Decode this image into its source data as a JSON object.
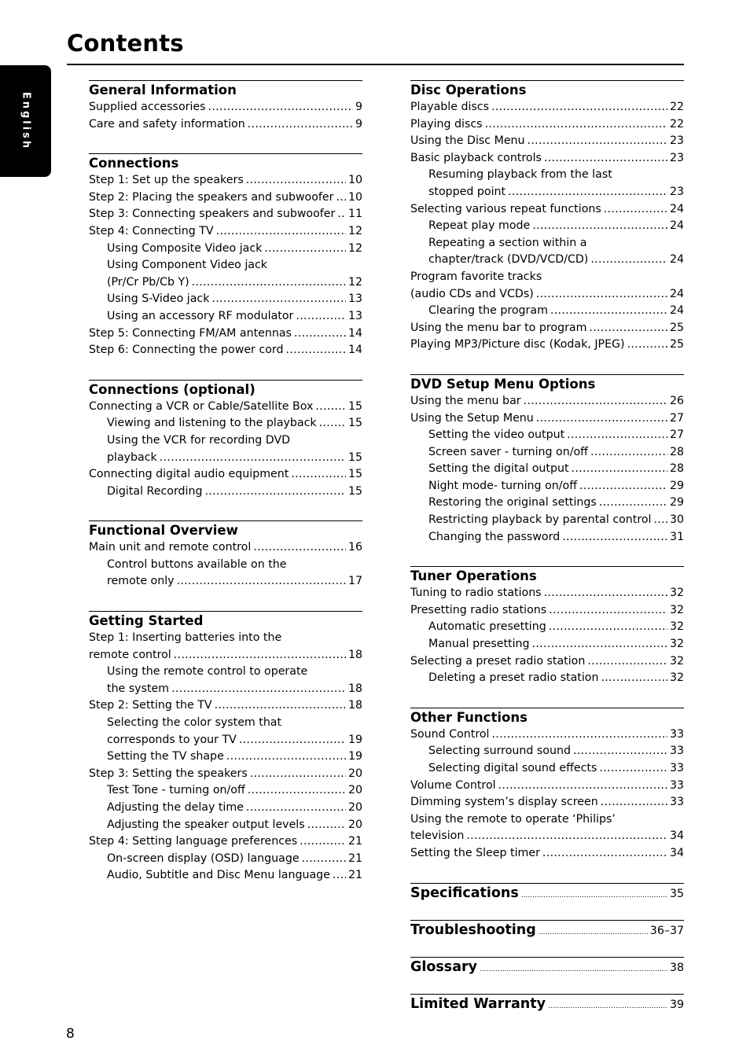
{
  "title": "Contents",
  "language_tab": "English",
  "page_number": "8",
  "left_column": [
    {
      "heading": "General Information",
      "entries": [
        {
          "label": "Supplied accessories",
          "page": "9",
          "indent": false
        },
        {
          "label": "Care and safety information",
          "page": "9",
          "indent": false
        }
      ]
    },
    {
      "heading": "Connections",
      "entries": [
        {
          "label": "Step 1: Set up the speakers",
          "page": "10",
          "indent": false
        },
        {
          "label": "Step 2: Placing the speakers and subwoofer",
          "page": "10",
          "indent": false
        },
        {
          "label": "Step 3: Connecting speakers and subwoofer",
          "page": "11",
          "indent": false
        },
        {
          "label": "Step 4: Connecting TV",
          "page": "12",
          "indent": false
        },
        {
          "label": "Using Composite Video jack",
          "page": "12",
          "indent": true
        },
        {
          "label": "Using Component Video jack",
          "page": "",
          "indent": true,
          "wrap": true
        },
        {
          "label": "(Pr/Cr Pb/Cb Y)",
          "page": "12",
          "indent": true
        },
        {
          "label": "Using S-Video jack",
          "page": "13",
          "indent": true
        },
        {
          "label": "Using an accessory RF modulator",
          "page": "13",
          "indent": true
        },
        {
          "label": "Step 5: Connecting FM/AM antennas",
          "page": "14",
          "indent": false
        },
        {
          "label": "Step 6: Connecting the power cord",
          "page": "14",
          "indent": false
        }
      ]
    },
    {
      "heading": "Connections (optional)",
      "entries": [
        {
          "label": "Connecting a VCR or Cable/Satellite Box",
          "page": "15",
          "indent": false
        },
        {
          "label": "Viewing and listening to the playback",
          "page": "15",
          "indent": true
        },
        {
          "label": "Using the VCR for recording DVD",
          "page": "",
          "indent": true,
          "wrap": true
        },
        {
          "label": "playback",
          "page": "15",
          "indent": true
        },
        {
          "label": "Connecting digital audio equipment",
          "page": "15",
          "indent": false
        },
        {
          "label": "Digital Recording",
          "page": "15",
          "indent": true
        }
      ]
    },
    {
      "heading": "Functional Overview",
      "entries": [
        {
          "label": "Main unit and remote control",
          "page": "16",
          "indent": false
        },
        {
          "label": "Control buttons available on the",
          "page": "",
          "indent": true,
          "wrap": true
        },
        {
          "label": "remote only",
          "page": "17",
          "indent": true
        }
      ]
    },
    {
      "heading": "Getting Started",
      "entries": [
        {
          "label": "Step 1: Inserting batteries into the",
          "page": "",
          "indent": false,
          "wrap": true
        },
        {
          "label": "remote control",
          "page": "18",
          "indent": false
        },
        {
          "label": "Using the remote control to operate",
          "page": "",
          "indent": true,
          "wrap": true
        },
        {
          "label": "the system",
          "page": "18",
          "indent": true
        },
        {
          "label": "Step 2: Setting the TV",
          "page": "18",
          "indent": false
        },
        {
          "label": "Selecting the color system that",
          "page": "",
          "indent": true,
          "wrap": true
        },
        {
          "label": "corresponds to your TV",
          "page": "19",
          "indent": true
        },
        {
          "label": "Setting the TV shape",
          "page": "19",
          "indent": true
        },
        {
          "label": "Step 3: Setting the speakers",
          "page": "20",
          "indent": false
        },
        {
          "label": "Test Tone - turning on/off",
          "page": "20",
          "indent": true
        },
        {
          "label": "Adjusting the delay time",
          "page": "20",
          "indent": true
        },
        {
          "label": "Adjusting the speaker output levels",
          "page": "20",
          "indent": true
        },
        {
          "label": "Step 4: Setting language preferences",
          "page": "21",
          "indent": false
        },
        {
          "label": "On-screen display (OSD) language",
          "page": "21",
          "indent": true
        },
        {
          "label": "Audio, Subtitle and Disc Menu language",
          "page": "21",
          "indent": true
        }
      ]
    }
  ],
  "right_column": [
    {
      "heading": "Disc Operations",
      "entries": [
        {
          "label": "Playable discs",
          "page": "22",
          "indent": false
        },
        {
          "label": "Playing discs",
          "page": "22",
          "indent": false
        },
        {
          "label": "Using the Disc Menu",
          "page": "23",
          "indent": false
        },
        {
          "label": "Basic playback controls",
          "page": "23",
          "indent": false
        },
        {
          "label": "Resuming playback from the last",
          "page": "",
          "indent": true,
          "wrap": true
        },
        {
          "label": "stopped point",
          "page": "23",
          "indent": true
        },
        {
          "label": "Selecting various repeat functions",
          "page": "24",
          "indent": false
        },
        {
          "label": "Repeat play mode",
          "page": "24",
          "indent": true
        },
        {
          "label": "Repeating a section within a",
          "page": "",
          "indent": true,
          "wrap": true
        },
        {
          "label": "chapter/track (DVD/VCD/CD)",
          "page": "24",
          "indent": true
        },
        {
          "label": "Program favorite tracks",
          "page": "",
          "indent": false,
          "wrap": true
        },
        {
          "label": "(audio CDs and VCDs)",
          "page": "24",
          "indent": false
        },
        {
          "label": "Clearing the program",
          "page": "24",
          "indent": true
        },
        {
          "label": "Using the menu bar to program",
          "page": "25",
          "indent": false
        },
        {
          "label": "Playing MP3/Picture disc (Kodak, JPEG)",
          "page": "25",
          "indent": false
        }
      ]
    },
    {
      "heading": "DVD Setup Menu Options",
      "entries": [
        {
          "label": "Using the menu bar",
          "page": "26",
          "indent": false
        },
        {
          "label": "Using the Setup Menu",
          "page": "27",
          "indent": false
        },
        {
          "label": "Setting the video output",
          "page": "27",
          "indent": true
        },
        {
          "label": "Screen saver - turning on/off",
          "page": "28",
          "indent": true
        },
        {
          "label": "Setting the digital output",
          "page": "28",
          "indent": true
        },
        {
          "label": "Night mode- turning on/off",
          "page": "29",
          "indent": true
        },
        {
          "label": "Restoring the original settings",
          "page": "29",
          "indent": true
        },
        {
          "label": "Restricting playback by parental control",
          "page": "30",
          "indent": true
        },
        {
          "label": "Changing the password",
          "page": "31",
          "indent": true
        }
      ]
    },
    {
      "heading": "Tuner Operations",
      "entries": [
        {
          "label": "Tuning to radio stations",
          "page": "32",
          "indent": false
        },
        {
          "label": "Presetting radio stations",
          "page": "32",
          "indent": false
        },
        {
          "label": "Automatic presetting",
          "page": "32",
          "indent": true
        },
        {
          "label": "Manual presetting",
          "page": "32",
          "indent": true
        },
        {
          "label": "Selecting a preset radio station",
          "page": "32",
          "indent": false
        },
        {
          "label": "Deleting a preset radio station",
          "page": "32",
          "indent": true
        }
      ]
    },
    {
      "heading": "Other Functions",
      "entries": [
        {
          "label": "Sound Control",
          "page": "33",
          "indent": false
        },
        {
          "label": "Selecting surround sound",
          "page": "33",
          "indent": true
        },
        {
          "label": "Selecting digital sound effects",
          "page": "33",
          "indent": true
        },
        {
          "label": "Volume Control",
          "page": "33",
          "indent": false
        },
        {
          "label": "Dimming system’s display screen",
          "page": "33",
          "indent": false
        },
        {
          "label": "Using the remote to operate ‘Philips’",
          "page": "",
          "indent": false,
          "wrap": true
        },
        {
          "label": "television",
          "page": "34",
          "indent": false
        },
        {
          "label": "Setting the Sleep timer",
          "page": "34",
          "indent": false
        }
      ]
    }
  ],
  "major_entries": [
    {
      "label": "Specifications",
      "page": "35"
    },
    {
      "label": "Troubleshooting",
      "page": "36–37"
    },
    {
      "label": "Glossary",
      "page": "38"
    },
    {
      "label": "Limited Warranty",
      "page": "39"
    }
  ]
}
